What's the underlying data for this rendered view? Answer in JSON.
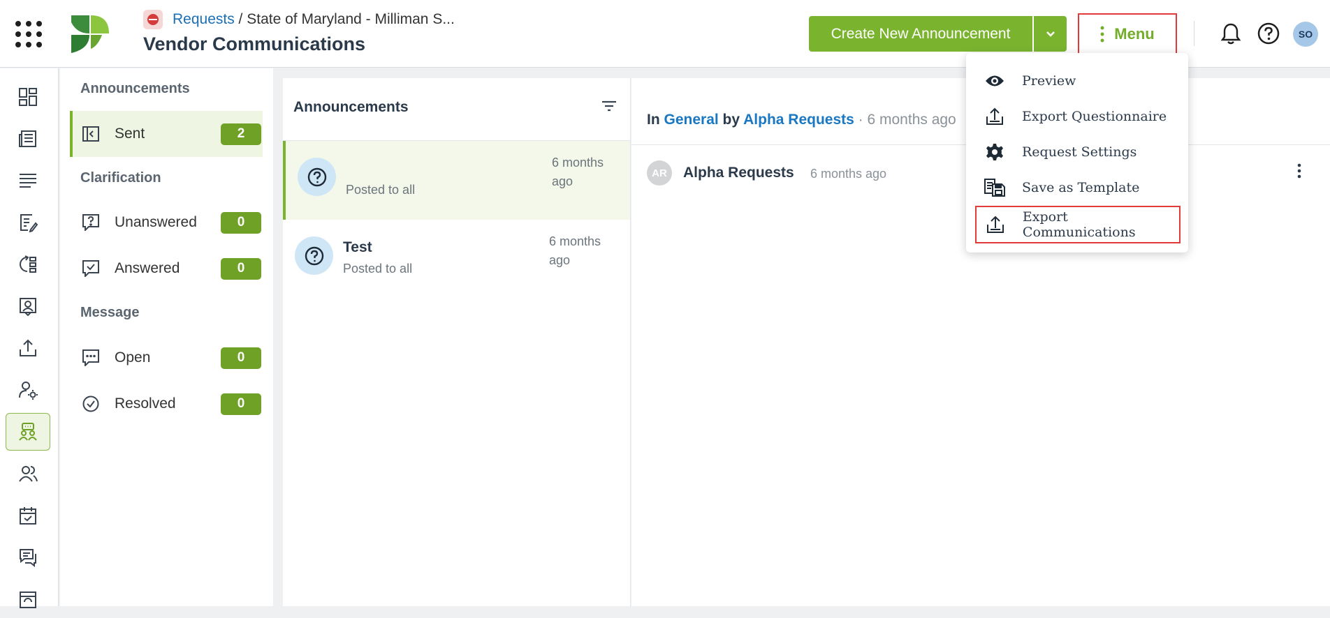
{
  "header": {
    "breadcrumb_link": "Requests",
    "breadcrumb_sep": " / ",
    "breadcrumb_current": "State of Maryland - Milliman S...",
    "page_title": "Vendor Communications",
    "create_button": "Create New Announcement",
    "menu_button": "Menu",
    "avatar_initials": "SO"
  },
  "subnav": {
    "sections": [
      {
        "title": "Announcements"
      },
      {
        "title": "Clarification"
      },
      {
        "title": "Message"
      }
    ],
    "items": [
      {
        "label": "Sent",
        "count": "2",
        "icon": "sent-icon"
      },
      {
        "label": "Unanswered",
        "count": "0",
        "icon": "unanswered-icon"
      },
      {
        "label": "Answered",
        "count": "0",
        "icon": "answered-icon"
      },
      {
        "label": "Open",
        "count": "0",
        "icon": "open-message-icon"
      },
      {
        "label": "Resolved",
        "count": "0",
        "icon": "resolved-icon"
      }
    ]
  },
  "list": {
    "title": "Announcements",
    "items": [
      {
        "title": "",
        "subtitle": "Posted to all",
        "time": "6 months ago"
      },
      {
        "title": "Test",
        "subtitle": "Posted to all",
        "time": "6 months ago"
      }
    ]
  },
  "detail": {
    "prefix": "In ",
    "category": "General",
    "by": " by ",
    "author_link": "Alpha Requests",
    "ago": " · 6 months ago",
    "post_avatar": "AR",
    "post_author": "Alpha Requests",
    "post_time": "6 months ago"
  },
  "dropdown": {
    "items": [
      {
        "label": "Preview",
        "icon": "eye-icon"
      },
      {
        "label": "Export Questionnaire",
        "icon": "export-icon"
      },
      {
        "label": "Request Settings",
        "icon": "gear-icon"
      },
      {
        "label": "Save as Template",
        "icon": "save-template-icon"
      },
      {
        "label": "Export Communications",
        "icon": "export-icon"
      }
    ]
  },
  "colors": {
    "brand_green": "#7ab42f",
    "badge_green": "#6ea126",
    "link_blue": "#1a78c2",
    "highlight_red": "#e23b3b"
  }
}
